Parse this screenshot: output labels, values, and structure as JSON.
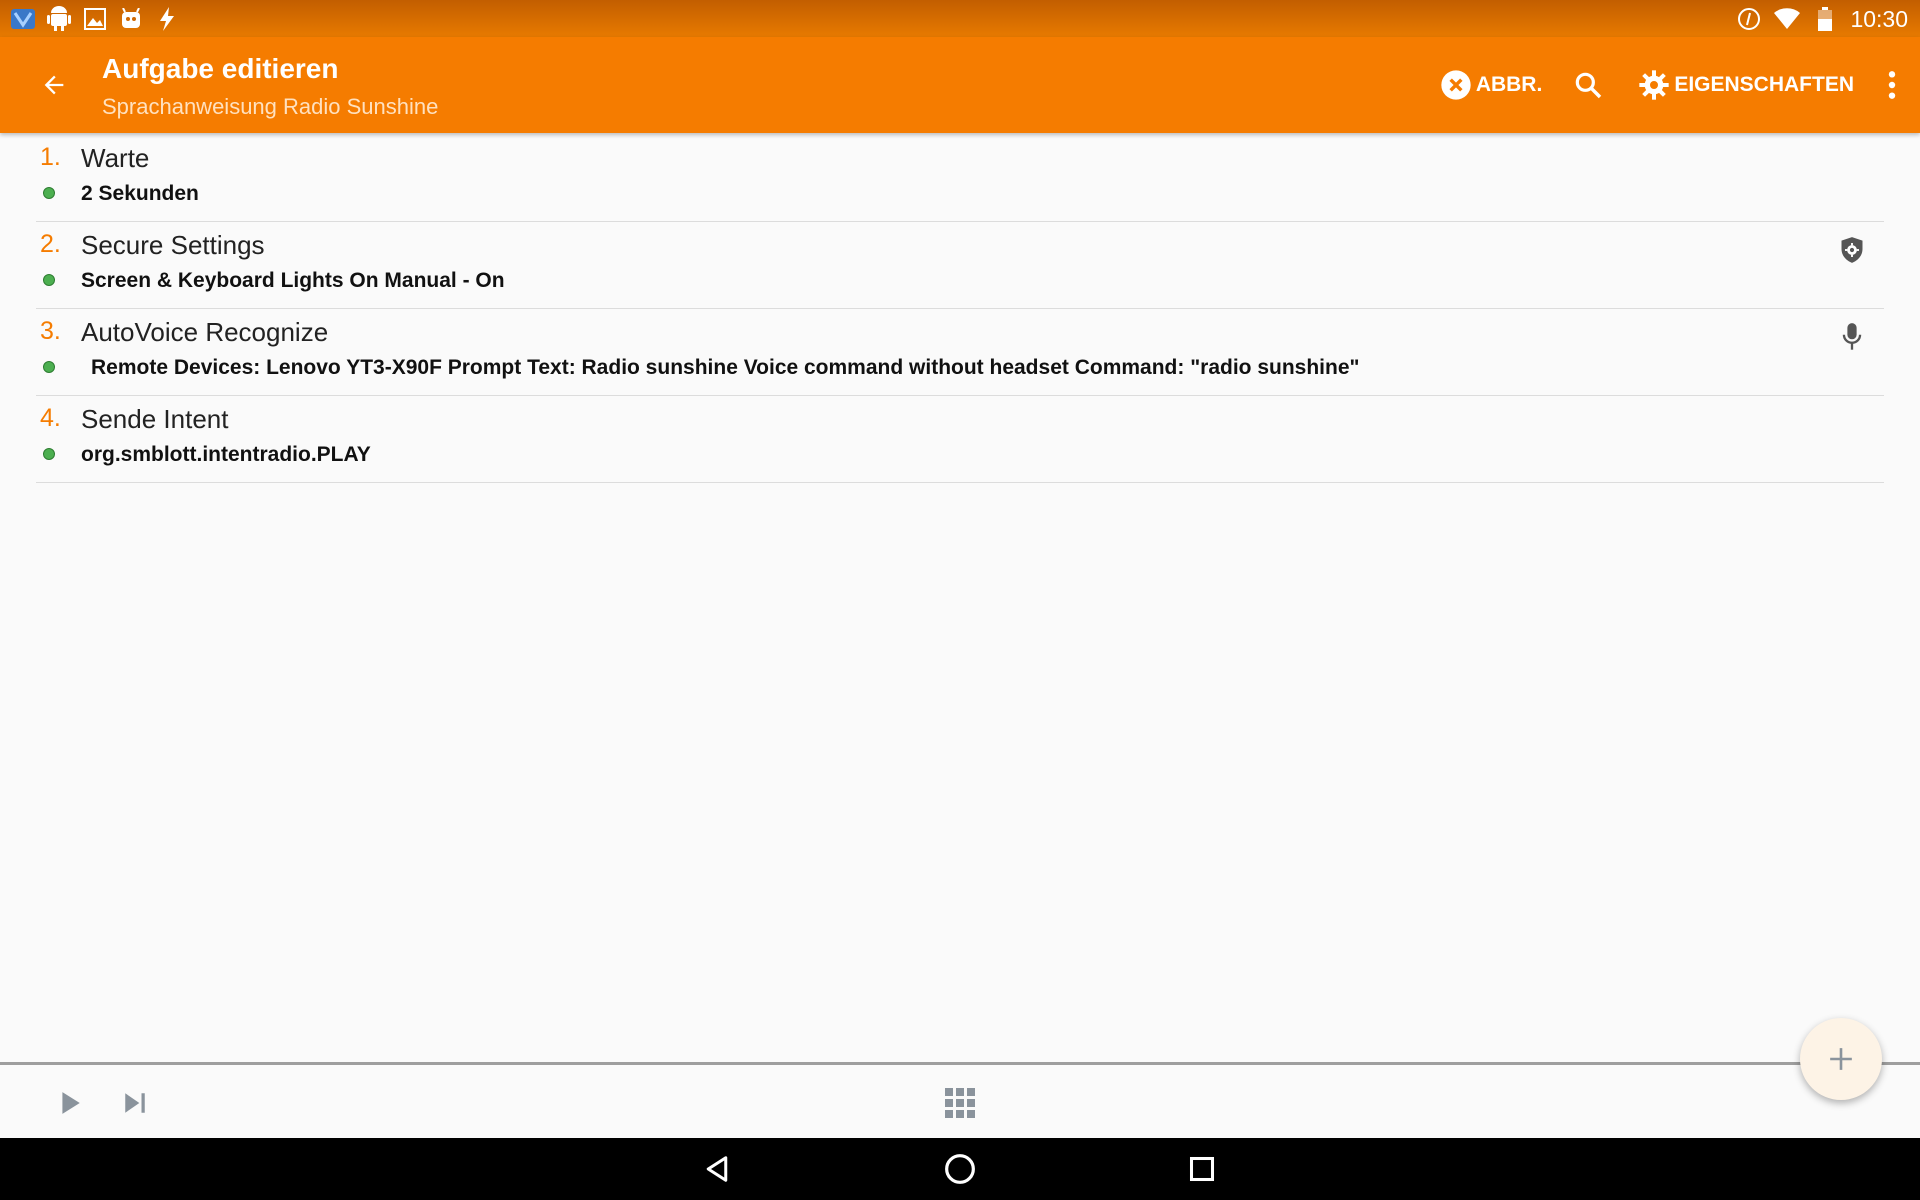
{
  "status_bar": {
    "time": "10:30",
    "left_icons": [
      "app-icon",
      "android-icon",
      "image-icon",
      "android-face-icon",
      "flash-icon"
    ],
    "right_icons": [
      "sync-icon",
      "wifi-icon",
      "battery-icon"
    ]
  },
  "appbar": {
    "title": "Aufgabe editieren",
    "subtitle": "Sprachanweisung Radio Sunshine",
    "cancel_label": "ABBR.",
    "properties_label": "EIGENSCHAFTEN",
    "colors": {
      "bar": "#f57c00",
      "status": "#d06800"
    }
  },
  "actions": [
    {
      "number": "1.",
      "name": "Warte",
      "detail": "2 Sekunden",
      "icon": ""
    },
    {
      "number": "2.",
      "name": "Secure Settings",
      "detail": "Screen & Keyboard Lights On Manual - On",
      "icon": "shield-gear-icon"
    },
    {
      "number": "3.",
      "name": "AutoVoice Recognize",
      "detail": "Remote Devices: Lenovo YT3-X90F Prompt Text: Radio sunshine Voice command without headset Command: \"radio sunshine\"",
      "icon": "microphone-icon"
    },
    {
      "number": "4.",
      "name": "Sende Intent",
      "detail": "org.smblott.intentradio.PLAY",
      "icon": ""
    }
  ],
  "bottom_bar": {
    "icons": [
      "play-icon",
      "skip-next-icon",
      "grid-icon"
    ]
  },
  "fab": {
    "icon": "plus-icon"
  },
  "navbar": {
    "icons": [
      "back-triangle-icon",
      "home-circle-icon",
      "recents-square-icon"
    ]
  }
}
